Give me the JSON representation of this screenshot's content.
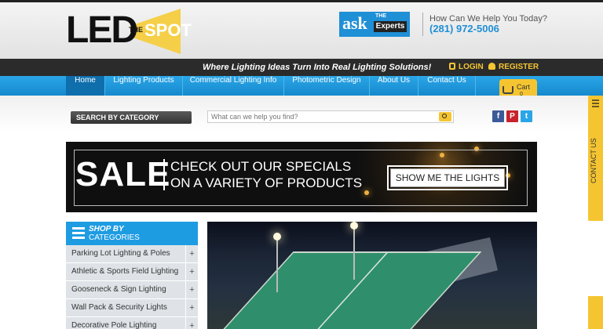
{
  "header": {
    "logo": {
      "main": "LED",
      "the": "THE",
      "spot": "SPOT"
    },
    "ask_experts": {
      "ask": "ask",
      "the": "THE",
      "experts": "Experts"
    },
    "help_label": "How Can We Help You Today?",
    "phone": "(281) 972-5006"
  },
  "tagbar": {
    "tagline": "Where Lighting Ideas Turn Into Real Lighting Solutions!",
    "login": "LOGIN",
    "register": "REGISTER"
  },
  "nav": {
    "items": [
      "Home",
      "Lighting Products",
      "Commercial Lighting Info",
      "Photometric Design",
      "About Us",
      "Contact Us"
    ],
    "active": "Home"
  },
  "cart": {
    "label": "Cart",
    "count": "0"
  },
  "search": {
    "category_button": "SEARCH BY CATEGORY",
    "placeholder": "What can we help you find?"
  },
  "social": [
    "f",
    "P",
    "t"
  ],
  "banner": {
    "sale": "SALE",
    "line1": "CHECK OUT OUR SPECIALS",
    "line2": "ON A VARIETY OF PRODUCTS",
    "button": "SHOW ME THE LIGHTS"
  },
  "categories": {
    "heading_1": "SHOP BY",
    "heading_2": "CATEGORIES",
    "items": [
      "Parking Lot Lighting & Poles",
      "Athletic & Sports Field Lighting",
      "Gooseneck & Sign Lighting",
      "Wall Pack & Security Lights",
      "Decorative Pole Lighting"
    ],
    "expand_symbol": "+"
  },
  "contact_tab": "CONTACT US",
  "colors": {
    "accent_blue": "#1e9ce2",
    "accent_yellow": "#f5c531",
    "dark_bar": "#2b2b2b"
  }
}
